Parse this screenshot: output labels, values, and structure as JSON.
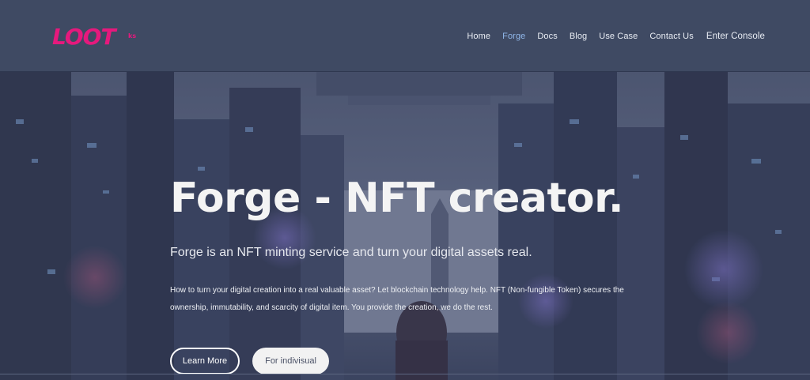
{
  "brand": {
    "logo_text": "LOOT",
    "logo_suffix": "ks",
    "logo_color": "#e6197d"
  },
  "nav": {
    "items": [
      {
        "label": "Home",
        "active": false
      },
      {
        "label": "Forge",
        "active": true
      },
      {
        "label": "Docs",
        "active": false
      },
      {
        "label": "Blog",
        "active": false
      },
      {
        "label": "Use Case",
        "active": false
      },
      {
        "label": "Contact Us",
        "active": false
      }
    ],
    "console_label": "Enter Console"
  },
  "hero": {
    "title": "Forge - NFT creator.",
    "subtitle": "Forge is an NFT minting service and turn your digital assets real.",
    "description": "How to turn your digital creation into a real valuable asset? Let blockchain technology help. NFT (Non-fungible Token) secures the ownership, immutability, and scarcity of digital item. You provide the creation, we do the rest.",
    "learn_more_label": "Learn More",
    "individual_label": "For indivisual"
  },
  "colors": {
    "nav_bg": "#3f4a63",
    "active_link": "#8fb6e8",
    "hero_overlay": "#3a4360"
  }
}
